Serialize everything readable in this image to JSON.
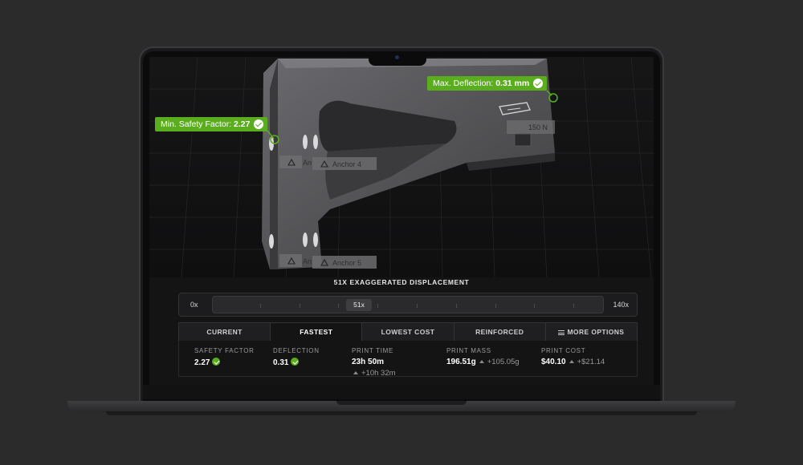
{
  "annotations": {
    "safety": {
      "label": "Min. Safety Factor:",
      "value": "2.27"
    },
    "deflection": {
      "label": "Max. Deflection:",
      "value": "0.31 mm"
    }
  },
  "model_labels": {
    "anchor_4": "Anchor 4",
    "anchor_5": "Anchor 5",
    "anchor_4_partial": "An",
    "anchor_5_partial": "An",
    "load": "150 N"
  },
  "displacement": {
    "title": "51X EXAGGERATED DISPLACEMENT",
    "min_label": "0x",
    "max_label": "140x",
    "current": "51x",
    "fraction": 0.36
  },
  "tabs": [
    "CURRENT",
    "FASTEST",
    "LOWEST COST",
    "REINFORCED",
    "MORE OPTIONS"
  ],
  "active_tab": "FASTEST",
  "stats": {
    "safety_factor": {
      "label": "SAFETY FACTOR",
      "value": "2.27"
    },
    "deflection": {
      "label": "DEFLECTION",
      "value": "0.31"
    },
    "print_time": {
      "label": "PRINT TIME",
      "value": "23h 50m",
      "delta": "+10h 32m"
    },
    "print_mass": {
      "label": "PRINT MASS",
      "value": "196.51g",
      "delta": "+105.05g"
    },
    "print_cost": {
      "label": "PRINT COST",
      "value": "$40.10",
      "delta": "+$21.14"
    }
  },
  "colors": {
    "accent_green": "#5aae1e",
    "background": "#2b2b2b",
    "screen": "#141415"
  },
  "icons": [
    "anchor-triangle-icon",
    "check-circle-icon",
    "arrow-up-icon",
    "menu-icon",
    "force-arrow-icon"
  ]
}
